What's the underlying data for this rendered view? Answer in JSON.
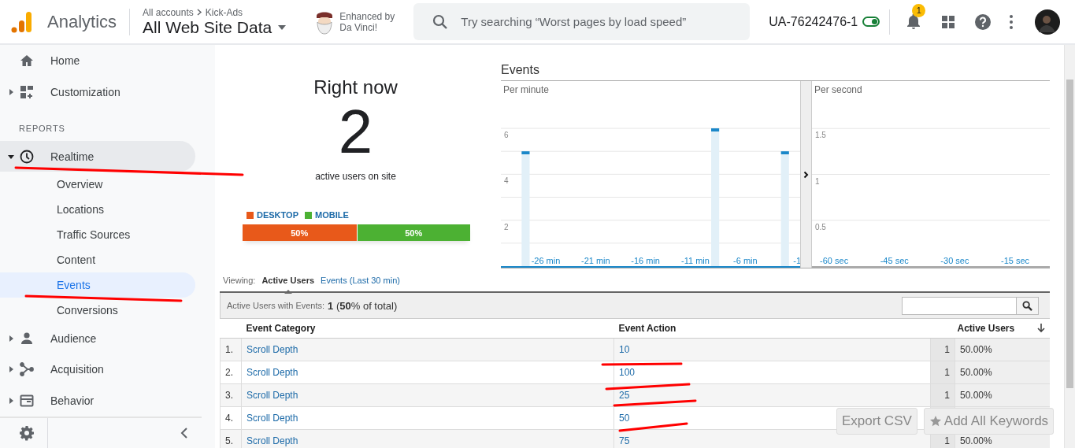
{
  "header": {
    "product": "Analytics",
    "breadcrumb": [
      "All accounts",
      "Kick-Ads"
    ],
    "view": "All Web Site Data",
    "badge_text": [
      "Enhanced by",
      "Da Vinci!"
    ],
    "search": {
      "placeholder": "Try searching “Worst pages by load speed”"
    },
    "property_id": "UA-76242476-1",
    "toggle_on": true,
    "notifications": "1"
  },
  "sidebar": {
    "top_items": [
      {
        "label": "Home",
        "expandable": false,
        "expanded": false,
        "selected": false
      },
      {
        "label": "Customization",
        "expandable": true,
        "expanded": false,
        "selected": false
      }
    ],
    "section_label": "REPORTS",
    "report_items": [
      {
        "label": "Realtime",
        "expandable": true,
        "expanded": true,
        "selected": true,
        "children": [
          {
            "label": "Overview",
            "selected": false
          },
          {
            "label": "Locations",
            "selected": false
          },
          {
            "label": "Traffic Sources",
            "selected": false
          },
          {
            "label": "Content",
            "selected": false
          },
          {
            "label": "Events",
            "selected": true
          },
          {
            "label": "Conversions",
            "selected": false
          }
        ]
      },
      {
        "label": "Audience",
        "expandable": true,
        "expanded": false,
        "selected": false
      },
      {
        "label": "Acquisition",
        "expandable": true,
        "expanded": false,
        "selected": false
      },
      {
        "label": "Behavior",
        "expandable": true,
        "expanded": false,
        "selected": false
      }
    ]
  },
  "right_now": {
    "title": "Right now",
    "count": "2",
    "caption": "active users on site",
    "devices": [
      {
        "label": "DESKTOP",
        "color": "#e8591a",
        "level": 0.5,
        "share": "50%"
      },
      {
        "label": "MOBILE",
        "color": "#4cb133",
        "level": 0.5,
        "share": "50%"
      }
    ]
  },
  "events": {
    "title": "Events",
    "per_minute": {
      "title": "Per minute",
      "chart_data": {
        "type": "bar",
        "x": [
          -28,
          -9,
          -2
        ],
        "values": [
          5,
          6,
          5
        ],
        "xlim": [
          -30.5,
          -0.5
        ],
        "ylim": [
          0,
          6
        ],
        "yticks": [
          2,
          4,
          6
        ],
        "grid": true,
        "xticks": [
          {
            "value": -26,
            "label": "-26 min"
          },
          {
            "value": -21,
            "label": "-21 min"
          },
          {
            "value": -16,
            "label": "-16 min"
          },
          {
            "value": -11,
            "label": "-11 min"
          },
          {
            "value": -6,
            "label": "-6 min"
          },
          {
            "value": -1,
            "label": "-1"
          }
        ]
      }
    },
    "per_second": {
      "title": "Per second",
      "chart_data": {
        "type": "bar",
        "xlim": [
          -65.5,
          -6.4
        ],
        "ylim": [
          0,
          2
        ],
        "yticks": [
          0.5,
          1,
          1.5
        ],
        "grid": true,
        "xticks": [
          {
            "value": -60,
            "label": "-60 sec"
          },
          {
            "value": -45,
            "label": "-45 sec"
          },
          {
            "value": -30,
            "label": "-30 sec"
          },
          {
            "value": -15,
            "label": "-15 sec"
          }
        ]
      }
    }
  },
  "viewing": {
    "label": "Viewing:",
    "tabs": [
      {
        "label": "Active Users",
        "selected": true
      },
      {
        "label": "Events (Last 30 min)",
        "selected": false
      }
    ]
  },
  "summary": {
    "label": "Active Users with Events:",
    "value": "**1** (**50**% of total)"
  },
  "table": {
    "columns": [
      "Event Category",
      "Event Action",
      "Active Users"
    ],
    "rows": [
      {
        "index": "1.",
        "category": "Scroll Depth",
        "action": "10",
        "users": "1",
        "share": "50.00%"
      },
      {
        "index": "2.",
        "category": "Scroll Depth",
        "action": "100",
        "users": "1",
        "share": "50.00%"
      },
      {
        "index": "3.",
        "category": "Scroll Depth",
        "action": "25",
        "users": "1",
        "share": "50.00%"
      },
      {
        "index": "4.",
        "category": "Scroll Depth",
        "action": "50"
      },
      {
        "index": "5.",
        "category": "Scroll Depth",
        "action": "75",
        "users": "1",
        "share": "50.00%"
      }
    ]
  },
  "buttons": [
    "Export CSV",
    "Add All Keywords"
  ]
}
